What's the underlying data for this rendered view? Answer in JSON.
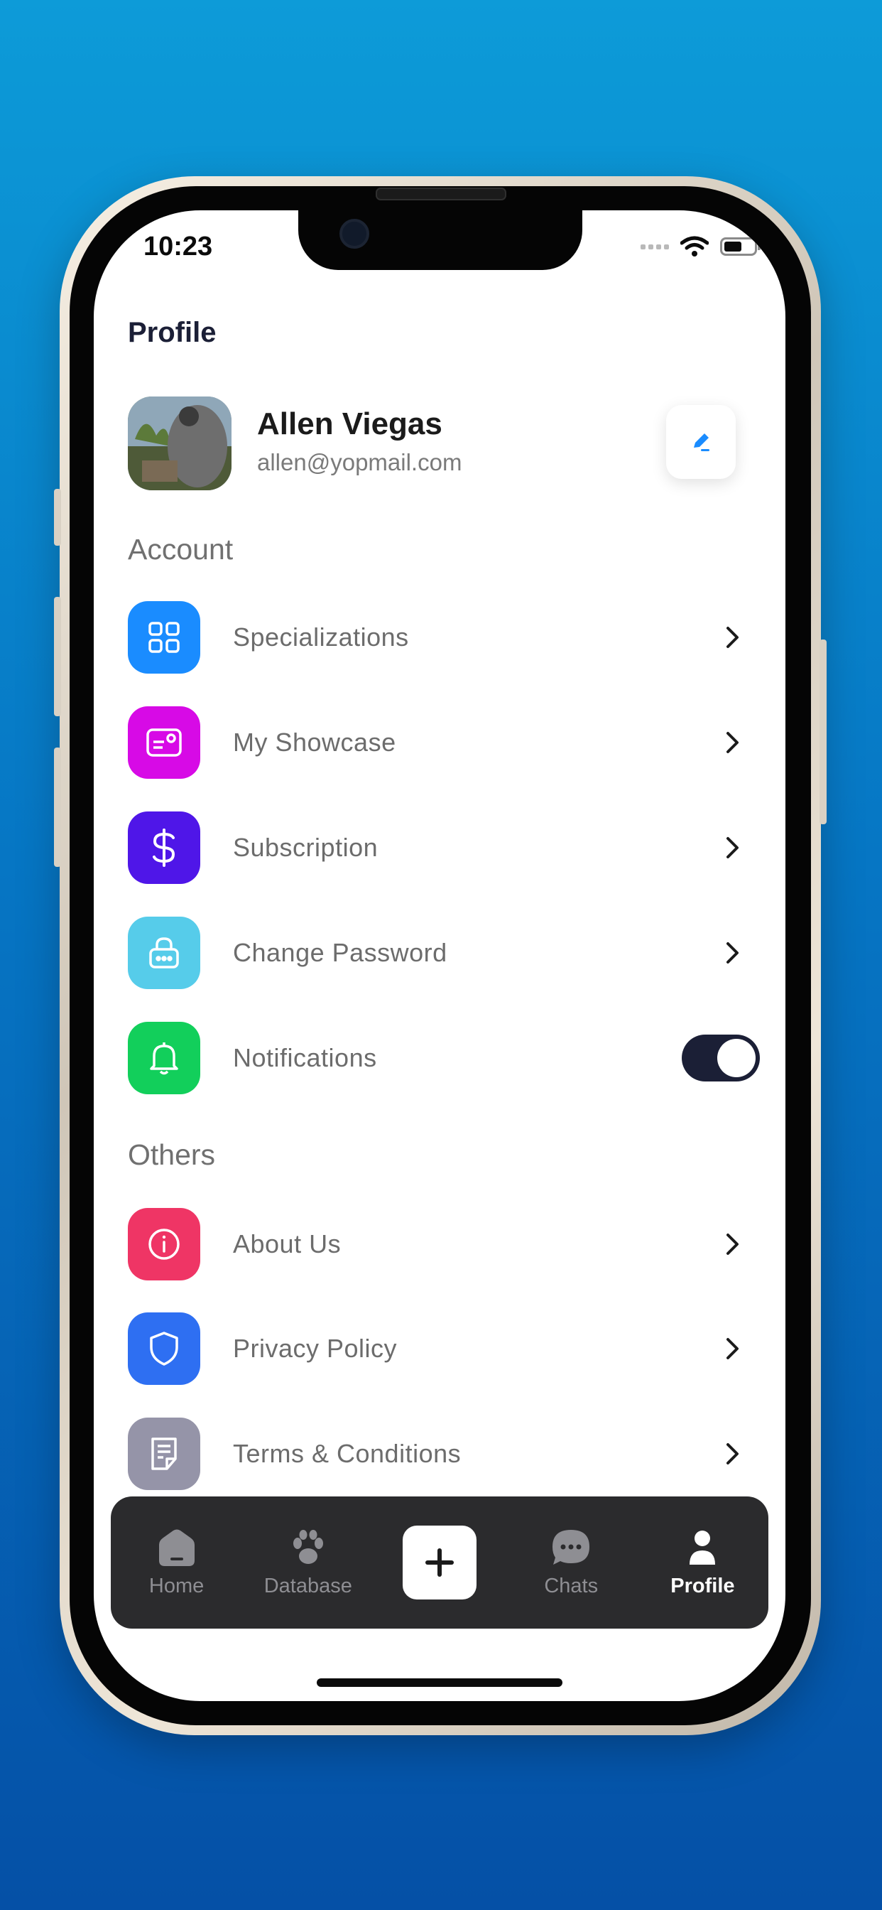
{
  "status_bar": {
    "time": "10:23"
  },
  "header": {
    "title": "Profile"
  },
  "user": {
    "name": "Allen Viegas",
    "email": "allen@yopmail.com"
  },
  "sections": {
    "account": "Account",
    "others": "Others"
  },
  "account_items": [
    {
      "label": "Specializations",
      "icon": "grid-icon",
      "color": "#1a8cff"
    },
    {
      "label": "My Showcase",
      "icon": "showcase-card-icon",
      "color": "#d70ae6"
    },
    {
      "label": "Subscription",
      "icon": "dollar-icon",
      "color": "#4f16e8"
    },
    {
      "label": "Change Password",
      "icon": "lock-icon",
      "color": "#56ccea"
    },
    {
      "label": "Notifications",
      "icon": "bell-icon",
      "color": "#12cf5b",
      "toggle_on": true
    }
  ],
  "other_items": [
    {
      "label": "About Us",
      "icon": "info-icon",
      "color": "#ef3565"
    },
    {
      "label": "Privacy Policy",
      "icon": "shield-icon",
      "color": "#2e6ff2"
    },
    {
      "label": "Terms & Conditions",
      "icon": "document-icon",
      "color": "#9594a8"
    }
  ],
  "tabbar": {
    "items": [
      {
        "label": "Home",
        "icon": "home-icon"
      },
      {
        "label": "Database",
        "icon": "paw-icon"
      },
      {
        "label": "",
        "icon": "plus-icon"
      },
      {
        "label": "Chats",
        "icon": "chat-bubble-icon"
      },
      {
        "label": "Profile",
        "icon": "person-icon",
        "active": true
      }
    ]
  },
  "colors": {
    "background": "#0676c4",
    "accent": "#1a8cff",
    "tabbar": "#2b2b2d",
    "title": "#1b1f36"
  }
}
